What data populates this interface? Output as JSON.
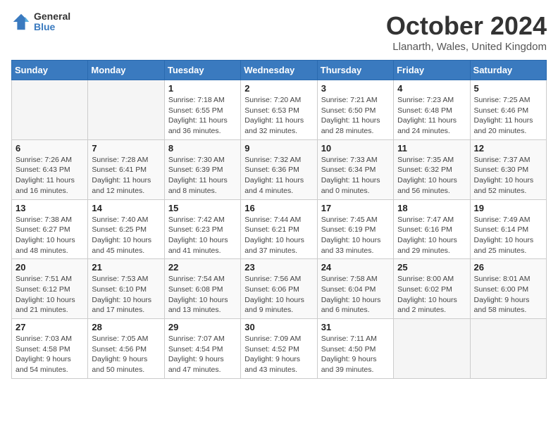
{
  "logo": {
    "general": "General",
    "blue": "Blue"
  },
  "title": "October 2024",
  "location": "Llanarth, Wales, United Kingdom",
  "days_of_week": [
    "Sunday",
    "Monday",
    "Tuesday",
    "Wednesday",
    "Thursday",
    "Friday",
    "Saturday"
  ],
  "weeks": [
    [
      {
        "day": "",
        "info": "",
        "empty": true
      },
      {
        "day": "",
        "info": "",
        "empty": true
      },
      {
        "day": "1",
        "info": "Sunrise: 7:18 AM\nSunset: 6:55 PM\nDaylight: 11 hours and 36 minutes.",
        "empty": false
      },
      {
        "day": "2",
        "info": "Sunrise: 7:20 AM\nSunset: 6:53 PM\nDaylight: 11 hours and 32 minutes.",
        "empty": false
      },
      {
        "day": "3",
        "info": "Sunrise: 7:21 AM\nSunset: 6:50 PM\nDaylight: 11 hours and 28 minutes.",
        "empty": false
      },
      {
        "day": "4",
        "info": "Sunrise: 7:23 AM\nSunset: 6:48 PM\nDaylight: 11 hours and 24 minutes.",
        "empty": false
      },
      {
        "day": "5",
        "info": "Sunrise: 7:25 AM\nSunset: 6:46 PM\nDaylight: 11 hours and 20 minutes.",
        "empty": false
      }
    ],
    [
      {
        "day": "6",
        "info": "Sunrise: 7:26 AM\nSunset: 6:43 PM\nDaylight: 11 hours and 16 minutes.",
        "empty": false
      },
      {
        "day": "7",
        "info": "Sunrise: 7:28 AM\nSunset: 6:41 PM\nDaylight: 11 hours and 12 minutes.",
        "empty": false
      },
      {
        "day": "8",
        "info": "Sunrise: 7:30 AM\nSunset: 6:39 PM\nDaylight: 11 hours and 8 minutes.",
        "empty": false
      },
      {
        "day": "9",
        "info": "Sunrise: 7:32 AM\nSunset: 6:36 PM\nDaylight: 11 hours and 4 minutes.",
        "empty": false
      },
      {
        "day": "10",
        "info": "Sunrise: 7:33 AM\nSunset: 6:34 PM\nDaylight: 11 hours and 0 minutes.",
        "empty": false
      },
      {
        "day": "11",
        "info": "Sunrise: 7:35 AM\nSunset: 6:32 PM\nDaylight: 10 hours and 56 minutes.",
        "empty": false
      },
      {
        "day": "12",
        "info": "Sunrise: 7:37 AM\nSunset: 6:30 PM\nDaylight: 10 hours and 52 minutes.",
        "empty": false
      }
    ],
    [
      {
        "day": "13",
        "info": "Sunrise: 7:38 AM\nSunset: 6:27 PM\nDaylight: 10 hours and 48 minutes.",
        "empty": false
      },
      {
        "day": "14",
        "info": "Sunrise: 7:40 AM\nSunset: 6:25 PM\nDaylight: 10 hours and 45 minutes.",
        "empty": false
      },
      {
        "day": "15",
        "info": "Sunrise: 7:42 AM\nSunset: 6:23 PM\nDaylight: 10 hours and 41 minutes.",
        "empty": false
      },
      {
        "day": "16",
        "info": "Sunrise: 7:44 AM\nSunset: 6:21 PM\nDaylight: 10 hours and 37 minutes.",
        "empty": false
      },
      {
        "day": "17",
        "info": "Sunrise: 7:45 AM\nSunset: 6:19 PM\nDaylight: 10 hours and 33 minutes.",
        "empty": false
      },
      {
        "day": "18",
        "info": "Sunrise: 7:47 AM\nSunset: 6:16 PM\nDaylight: 10 hours and 29 minutes.",
        "empty": false
      },
      {
        "day": "19",
        "info": "Sunrise: 7:49 AM\nSunset: 6:14 PM\nDaylight: 10 hours and 25 minutes.",
        "empty": false
      }
    ],
    [
      {
        "day": "20",
        "info": "Sunrise: 7:51 AM\nSunset: 6:12 PM\nDaylight: 10 hours and 21 minutes.",
        "empty": false
      },
      {
        "day": "21",
        "info": "Sunrise: 7:53 AM\nSunset: 6:10 PM\nDaylight: 10 hours and 17 minutes.",
        "empty": false
      },
      {
        "day": "22",
        "info": "Sunrise: 7:54 AM\nSunset: 6:08 PM\nDaylight: 10 hours and 13 minutes.",
        "empty": false
      },
      {
        "day": "23",
        "info": "Sunrise: 7:56 AM\nSunset: 6:06 PM\nDaylight: 10 hours and 9 minutes.",
        "empty": false
      },
      {
        "day": "24",
        "info": "Sunrise: 7:58 AM\nSunset: 6:04 PM\nDaylight: 10 hours and 6 minutes.",
        "empty": false
      },
      {
        "day": "25",
        "info": "Sunrise: 8:00 AM\nSunset: 6:02 PM\nDaylight: 10 hours and 2 minutes.",
        "empty": false
      },
      {
        "day": "26",
        "info": "Sunrise: 8:01 AM\nSunset: 6:00 PM\nDaylight: 9 hours and 58 minutes.",
        "empty": false
      }
    ],
    [
      {
        "day": "27",
        "info": "Sunrise: 7:03 AM\nSunset: 4:58 PM\nDaylight: 9 hours and 54 minutes.",
        "empty": false
      },
      {
        "day": "28",
        "info": "Sunrise: 7:05 AM\nSunset: 4:56 PM\nDaylight: 9 hours and 50 minutes.",
        "empty": false
      },
      {
        "day": "29",
        "info": "Sunrise: 7:07 AM\nSunset: 4:54 PM\nDaylight: 9 hours and 47 minutes.",
        "empty": false
      },
      {
        "day": "30",
        "info": "Sunrise: 7:09 AM\nSunset: 4:52 PM\nDaylight: 9 hours and 43 minutes.",
        "empty": false
      },
      {
        "day": "31",
        "info": "Sunrise: 7:11 AM\nSunset: 4:50 PM\nDaylight: 9 hours and 39 minutes.",
        "empty": false
      },
      {
        "day": "",
        "info": "",
        "empty": true
      },
      {
        "day": "",
        "info": "",
        "empty": true
      }
    ]
  ]
}
